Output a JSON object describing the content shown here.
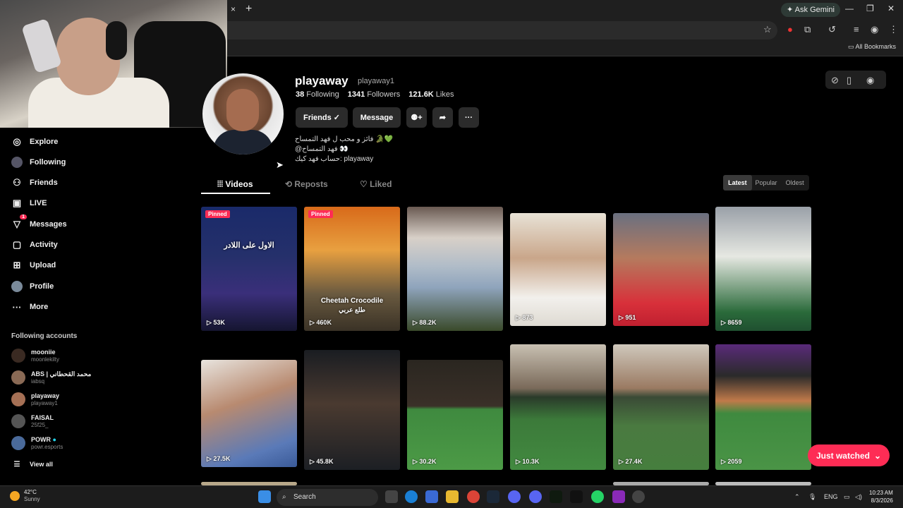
{
  "browser": {
    "tab_close": "×",
    "new_tab": "+",
    "ask_gemini": "Ask Gemini",
    "all_bookmarks": "All Bookmarks"
  },
  "sidebar": {
    "items": [
      {
        "label": "Explore",
        "icon": "compass-icon"
      },
      {
        "label": "Following",
        "icon": "following-icon"
      },
      {
        "label": "Friends",
        "icon": "friends-icon"
      },
      {
        "label": "LIVE",
        "icon": "live-icon"
      },
      {
        "label": "Messages",
        "icon": "messages-icon",
        "badge": "1"
      },
      {
        "label": "Activity",
        "icon": "activity-icon"
      },
      {
        "label": "Upload",
        "icon": "upload-icon"
      },
      {
        "label": "Profile",
        "icon": "profile-icon"
      },
      {
        "label": "More",
        "icon": "more-icon"
      }
    ],
    "following_title": "Following accounts",
    "accounts": [
      {
        "name": "mooniie",
        "handle": "moonlekilty"
      },
      {
        "name": "ABS | محمد القحطاني",
        "handle": "iabsq"
      },
      {
        "name": "playaway",
        "handle": "playaway1"
      },
      {
        "name": "FAISAL",
        "handle": "25f25_"
      },
      {
        "name": "POWR",
        "handle": "powr.esports"
      }
    ],
    "view_all": "View all"
  },
  "profile": {
    "username": "playaway",
    "handle": "playaway1",
    "following_count": "38",
    "following_label": "Following",
    "followers_count": "1341",
    "followers_label": "Followers",
    "likes_count": "121.6K",
    "likes_label": "Likes",
    "friends_button": "Friends ✓",
    "message_button": "Message",
    "bio_line1": "فائز و محب ل فهد التمساح 🐊💚",
    "bio_line2": "@فهد التمساح 👀",
    "bio_line3": "حساب فهد كيك: playaway"
  },
  "tabs": {
    "videos": "Videos",
    "reposts": "Reposts",
    "liked": "Liked"
  },
  "sort": {
    "latest": "Latest",
    "popular": "Popular",
    "oldest": "Oldest"
  },
  "videos": [
    {
      "views": "53K",
      "pinned": "Pinned",
      "caption": "الاول على اللادر"
    },
    {
      "views": "460K",
      "pinned": "Pinned",
      "caption": "Cheetah Crocodile",
      "caption2": "طلع عربي"
    },
    {
      "views": "88.2K"
    },
    {
      "views": "873"
    },
    {
      "views": "951"
    },
    {
      "views": "8659"
    },
    {
      "views": "27.5K"
    },
    {
      "views": "45.8K"
    },
    {
      "views": "30.2K"
    },
    {
      "views": "10.3K"
    },
    {
      "views": "27.4K"
    },
    {
      "views": "2059"
    }
  ],
  "just_watched": "Just watched",
  "taskbar": {
    "temp": "42°C",
    "weather": "Sunny",
    "search": "Search",
    "lang": "ENG",
    "time": "10:23 AM",
    "date": "8/3/2026"
  },
  "colors": {
    "accent": "#fe2c55",
    "background": "#000000"
  }
}
